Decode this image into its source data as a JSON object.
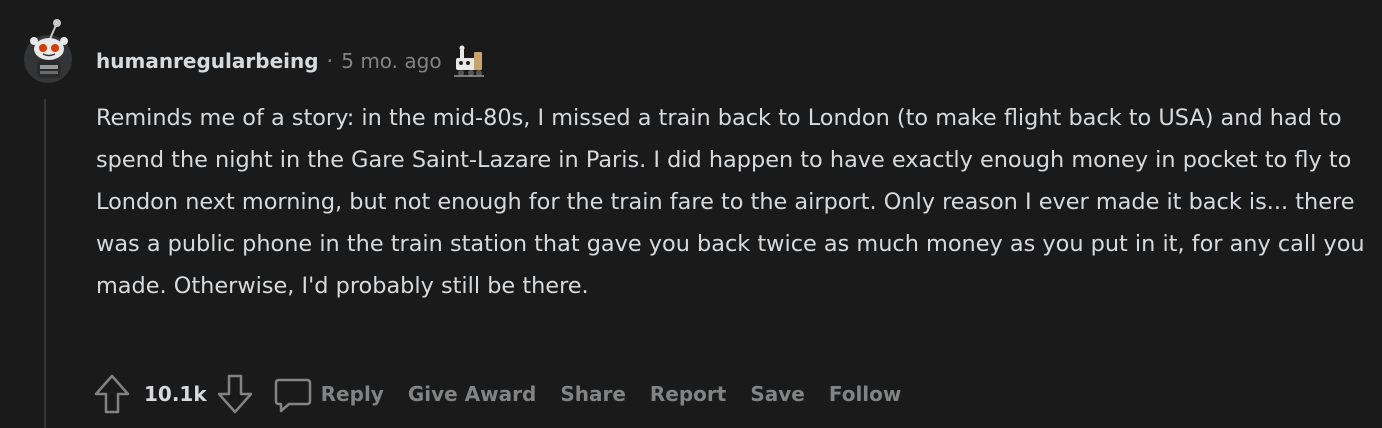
{
  "comment": {
    "username": "humanregularbeing",
    "separator": "·",
    "timestamp": "5 mo. ago",
    "body": "Reminds me of a story: in the mid-80s, I missed a train back to London (to make flight back to USA) and had to spend the night in the Gare Saint-Lazare in Paris. I did happen to have exactly enough money in pocket to fly to London next morning, but not enough for the train fare to the airport. Only reason I ever made it back is... there was a public phone in the train station that gave you back twice as much money as you put in it, for any call you made. Otherwise, I'd probably still be there."
  },
  "actions": {
    "score": "10.1k",
    "reply": "Reply",
    "give_award": "Give Award",
    "share": "Share",
    "report": "Report",
    "save": "Save",
    "follow": "Follow"
  },
  "icons": {
    "avatar": "reddit-snoo-avatar",
    "flair": "train-flair-icon",
    "upvote": "upvote-arrow-icon",
    "downvote": "downvote-arrow-icon",
    "comment": "comment-bubble-icon"
  },
  "colors": {
    "background": "#1a1a1b",
    "text_primary": "#d7dadc",
    "text_secondary": "#818384",
    "thread_line": "#343536"
  }
}
